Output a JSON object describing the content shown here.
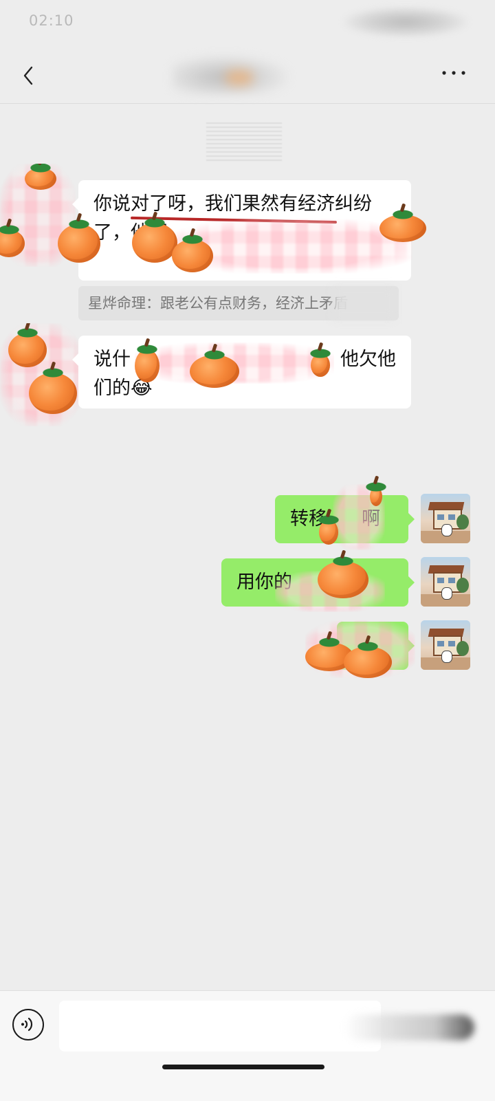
{
  "status_bar": {
    "time": "02:10"
  },
  "messages": {
    "in1_line1": "你说对了呀，我们果然有经济纠纷",
    "in1_line2": "了，他把",
    "quote": "星烨命理：跟老公有点财务，经济上矛盾",
    "in2_line1_a": "说什",
    "in2_line1_b": "他欠他",
    "in2_line2": "们的😂",
    "out1_a": "转移",
    "out1_b": "啊",
    "out2_a": "用你的",
    "out2_b": "？"
  },
  "input": {
    "placeholder": ""
  }
}
